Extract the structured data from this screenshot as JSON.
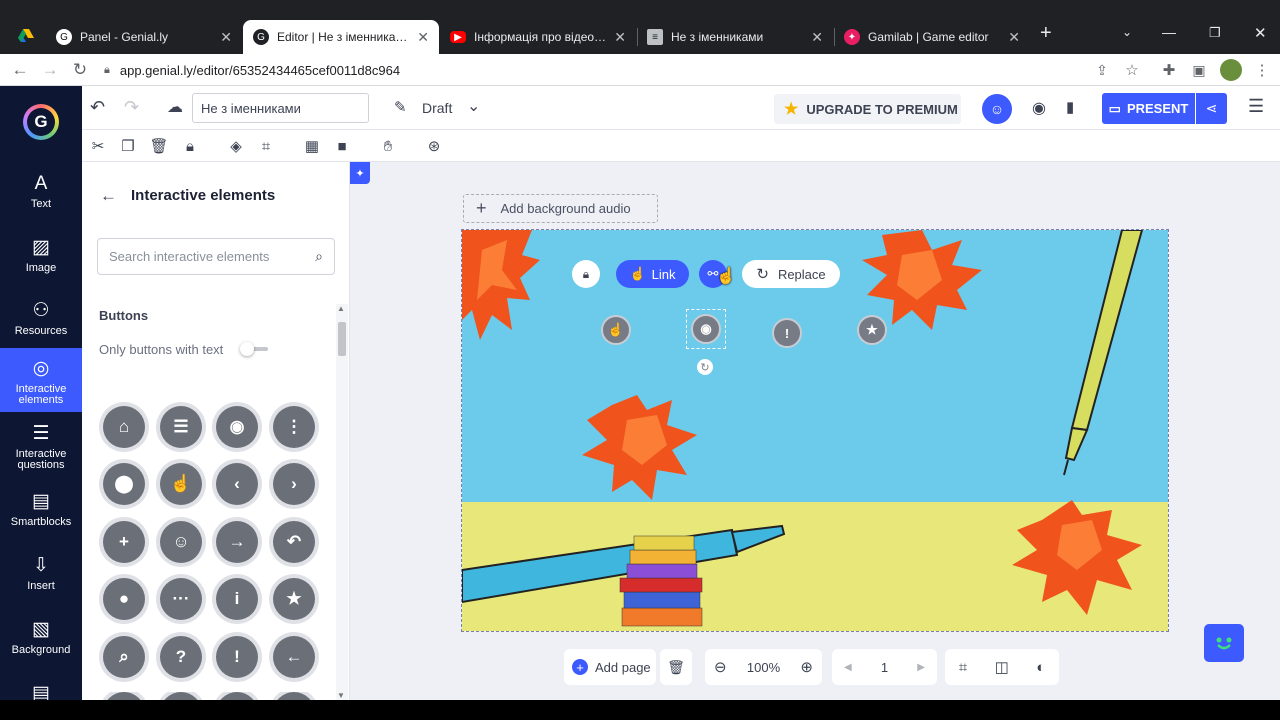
{
  "browser": {
    "tabs": [
      {
        "title": "Panel - Genial.ly",
        "active": false
      },
      {
        "title": "Editor | Не з іменниками",
        "active": true
      },
      {
        "title": "Інформація про відео - YouTube Studio",
        "active": false
      },
      {
        "title": "Не з іменниками",
        "active": false
      },
      {
        "title": "Gamilab | Game editor",
        "active": false
      }
    ],
    "new_tab": "+",
    "url": "app.genial.ly/editor/65352434465cef0011d8c964"
  },
  "topbar": {
    "doc_title": "Не з іменниками",
    "status": "Draft",
    "upgrade_label": "UPGRADE TO PREMIUM",
    "present_label": "PRESENT"
  },
  "rail": {
    "items": [
      {
        "label": "Text",
        "icon": "A"
      },
      {
        "label": "Image",
        "icon": "▨"
      },
      {
        "label": "Resources",
        "icon": "⚇"
      },
      {
        "label": "Interactive elements",
        "icon": "◎"
      },
      {
        "label": "Interactive questions",
        "icon": "☰"
      },
      {
        "label": "Smartblocks",
        "icon": "▤"
      },
      {
        "label": "Insert",
        "icon": "⇩"
      },
      {
        "label": "Background",
        "icon": "▧"
      }
    ]
  },
  "panel": {
    "title": "Interactive elements",
    "search_placeholder": "Search interactive elements",
    "section": "Buttons",
    "toggle_label": "Only buttons with text",
    "buttons": [
      [
        "⌂",
        "☰",
        "◉",
        "⋮"
      ],
      [
        "⬤",
        "☝",
        "‹",
        "›"
      ],
      [
        "+",
        "☺",
        "→",
        "↶"
      ],
      [
        "●",
        "···",
        "i",
        "★"
      ],
      [
        "⌕",
        "?",
        "!",
        "←"
      ]
    ]
  },
  "canvas": {
    "add_audio": "Add background audio",
    "link_label": "Link",
    "replace_label": "Replace",
    "on_canvas_buttons": [
      "☝",
      "◉",
      "!",
      "★"
    ]
  },
  "bottom": {
    "add_page": "Add page",
    "zoom": "100%",
    "page": "1"
  },
  "colors": {
    "accent": "#3d5afe",
    "rail_bg": "#0d1633",
    "sky": "#6ccbeb",
    "ground": "#e8e77a"
  }
}
